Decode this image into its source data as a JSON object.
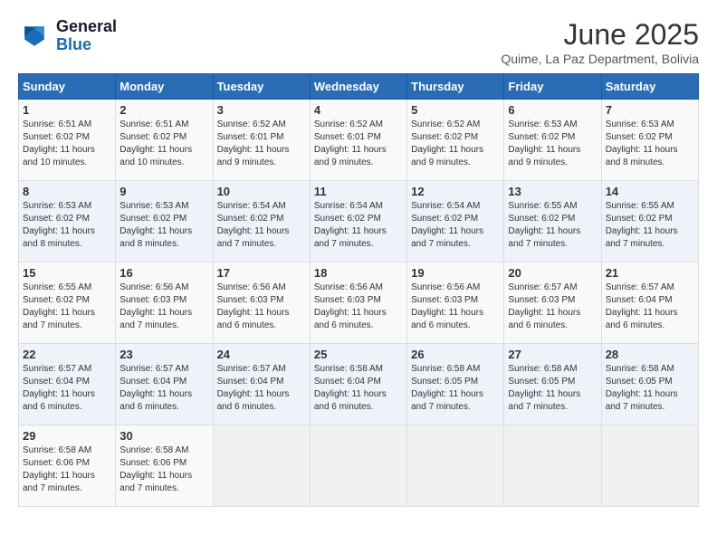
{
  "header": {
    "logo_line1": "General",
    "logo_line2": "Blue",
    "month": "June 2025",
    "location": "Quime, La Paz Department, Bolivia"
  },
  "weekdays": [
    "Sunday",
    "Monday",
    "Tuesday",
    "Wednesday",
    "Thursday",
    "Friday",
    "Saturday"
  ],
  "weeks": [
    [
      {
        "day": "1",
        "sunrise": "6:51 AM",
        "sunset": "6:02 PM",
        "daylight": "11 hours and 10 minutes."
      },
      {
        "day": "2",
        "sunrise": "6:51 AM",
        "sunset": "6:02 PM",
        "daylight": "11 hours and 10 minutes."
      },
      {
        "day": "3",
        "sunrise": "6:52 AM",
        "sunset": "6:01 PM",
        "daylight": "11 hours and 9 minutes."
      },
      {
        "day": "4",
        "sunrise": "6:52 AM",
        "sunset": "6:01 PM",
        "daylight": "11 hours and 9 minutes."
      },
      {
        "day": "5",
        "sunrise": "6:52 AM",
        "sunset": "6:02 PM",
        "daylight": "11 hours and 9 minutes."
      },
      {
        "day": "6",
        "sunrise": "6:53 AM",
        "sunset": "6:02 PM",
        "daylight": "11 hours and 9 minutes."
      },
      {
        "day": "7",
        "sunrise": "6:53 AM",
        "sunset": "6:02 PM",
        "daylight": "11 hours and 8 minutes."
      }
    ],
    [
      {
        "day": "8",
        "sunrise": "6:53 AM",
        "sunset": "6:02 PM",
        "daylight": "11 hours and 8 minutes."
      },
      {
        "day": "9",
        "sunrise": "6:53 AM",
        "sunset": "6:02 PM",
        "daylight": "11 hours and 8 minutes."
      },
      {
        "day": "10",
        "sunrise": "6:54 AM",
        "sunset": "6:02 PM",
        "daylight": "11 hours and 7 minutes."
      },
      {
        "day": "11",
        "sunrise": "6:54 AM",
        "sunset": "6:02 PM",
        "daylight": "11 hours and 7 minutes."
      },
      {
        "day": "12",
        "sunrise": "6:54 AM",
        "sunset": "6:02 PM",
        "daylight": "11 hours and 7 minutes."
      },
      {
        "day": "13",
        "sunrise": "6:55 AM",
        "sunset": "6:02 PM",
        "daylight": "11 hours and 7 minutes."
      },
      {
        "day": "14",
        "sunrise": "6:55 AM",
        "sunset": "6:02 PM",
        "daylight": "11 hours and 7 minutes."
      }
    ],
    [
      {
        "day": "15",
        "sunrise": "6:55 AM",
        "sunset": "6:02 PM",
        "daylight": "11 hours and 7 minutes."
      },
      {
        "day": "16",
        "sunrise": "6:56 AM",
        "sunset": "6:03 PM",
        "daylight": "11 hours and 7 minutes."
      },
      {
        "day": "17",
        "sunrise": "6:56 AM",
        "sunset": "6:03 PM",
        "daylight": "11 hours and 6 minutes."
      },
      {
        "day": "18",
        "sunrise": "6:56 AM",
        "sunset": "6:03 PM",
        "daylight": "11 hours and 6 minutes."
      },
      {
        "day": "19",
        "sunrise": "6:56 AM",
        "sunset": "6:03 PM",
        "daylight": "11 hours and 6 minutes."
      },
      {
        "day": "20",
        "sunrise": "6:57 AM",
        "sunset": "6:03 PM",
        "daylight": "11 hours and 6 minutes."
      },
      {
        "day": "21",
        "sunrise": "6:57 AM",
        "sunset": "6:04 PM",
        "daylight": "11 hours and 6 minutes."
      }
    ],
    [
      {
        "day": "22",
        "sunrise": "6:57 AM",
        "sunset": "6:04 PM",
        "daylight": "11 hours and 6 minutes."
      },
      {
        "day": "23",
        "sunrise": "6:57 AM",
        "sunset": "6:04 PM",
        "daylight": "11 hours and 6 minutes."
      },
      {
        "day": "24",
        "sunrise": "6:57 AM",
        "sunset": "6:04 PM",
        "daylight": "11 hours and 6 minutes."
      },
      {
        "day": "25",
        "sunrise": "6:58 AM",
        "sunset": "6:04 PM",
        "daylight": "11 hours and 6 minutes."
      },
      {
        "day": "26",
        "sunrise": "6:58 AM",
        "sunset": "6:05 PM",
        "daylight": "11 hours and 7 minutes."
      },
      {
        "day": "27",
        "sunrise": "6:58 AM",
        "sunset": "6:05 PM",
        "daylight": "11 hours and 7 minutes."
      },
      {
        "day": "28",
        "sunrise": "6:58 AM",
        "sunset": "6:05 PM",
        "daylight": "11 hours and 7 minutes."
      }
    ],
    [
      {
        "day": "29",
        "sunrise": "6:58 AM",
        "sunset": "6:06 PM",
        "daylight": "11 hours and 7 minutes."
      },
      {
        "day": "30",
        "sunrise": "6:58 AM",
        "sunset": "6:06 PM",
        "daylight": "11 hours and 7 minutes."
      },
      null,
      null,
      null,
      null,
      null
    ]
  ]
}
